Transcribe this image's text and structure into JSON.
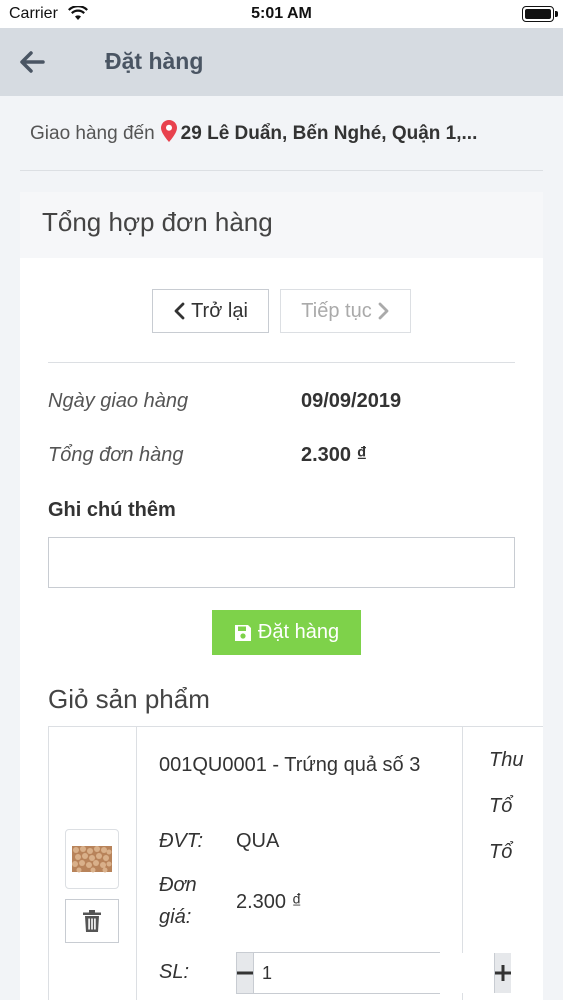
{
  "status_bar": {
    "carrier": "Carrier",
    "time": "5:01 AM"
  },
  "nav": {
    "title": "Đặt hàng"
  },
  "address": {
    "label": "Giao hàng đến",
    "value": "29 Lê Duẩn, Bến Nghé, Quận 1,..."
  },
  "summary": {
    "title": "Tổng hợp đơn hàng",
    "back_label": "Trở lại",
    "next_label": "Tiếp tục",
    "delivery_date_label": "Ngày giao hàng",
    "delivery_date": "09/09/2019",
    "order_total_label": "Tổng đơn hàng",
    "order_total": "2.300 ₫",
    "note_label": "Ghi chú thêm",
    "note_value": "",
    "place_order_label": "Đặt hàng"
  },
  "cart": {
    "title": "Giỏ sản phẩm",
    "items": [
      {
        "name": "001QU0001 - Trứng quả số 3",
        "unit_label": "ĐVT:",
        "unit": "QUA",
        "price_label_1": "Đơn",
        "price_label_2": "giá:",
        "price": "2.300 ₫",
        "qty_label": "SL:",
        "qty": "1",
        "side_labels": [
          "Thu",
          "Tổ",
          "Tổ"
        ]
      }
    ]
  },
  "colors": {
    "nav_bg": "#d6dbe1",
    "accent_green": "#7ed24a",
    "pin_red": "#e8414d"
  }
}
